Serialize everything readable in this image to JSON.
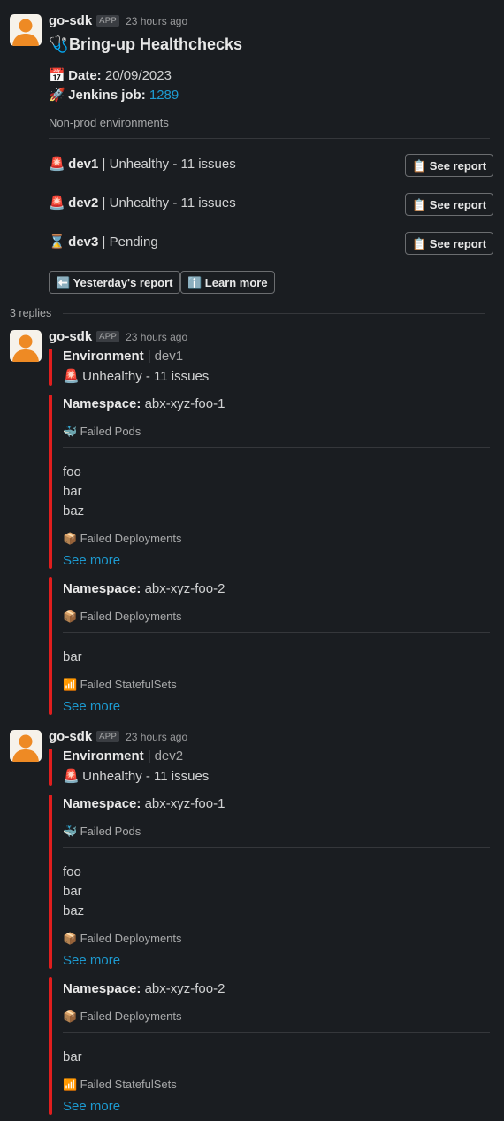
{
  "main": {
    "username": "go-sdk",
    "badge": "APP",
    "timestamp": "23 hours ago",
    "title_icon": "🩺",
    "title": "Bring-up Healthchecks",
    "date_icon": "📅",
    "date_label": "Date:",
    "date_value": "20/09/2023",
    "jenkins_icon": "🚀",
    "jenkins_label": "Jenkins job:",
    "jenkins_value": "1289",
    "section_label": "Non-prod environments",
    "environments": [
      {
        "icon": "🚨",
        "name": "dev1",
        "status": "| Unhealthy - 11 issues",
        "button": "📋 See report"
      },
      {
        "icon": "🚨",
        "name": "dev2",
        "status": "| Unhealthy - 11 issues",
        "button": "📋 See report"
      },
      {
        "icon": "⌛",
        "name": "dev3",
        "status": "| Pending",
        "button": "📋 See report"
      }
    ],
    "actions": {
      "yesterday": "⬅️ Yesterday's report",
      "learn_more": "ℹ️ Learn more"
    }
  },
  "replies_count": "3 replies",
  "replies": [
    {
      "username": "go-sdk",
      "badge": "APP",
      "timestamp": "23 hours ago",
      "env_label": "Environment",
      "env_value": "dev1",
      "status_icon": "🚨",
      "status": "Unhealthy - 11 issues",
      "namespaces": [
        {
          "label": "Namespace:",
          "name": "abx-xyz-foo-1",
          "cat1_icon": "🐳",
          "cat1": "Failed Pods",
          "items": [
            "foo",
            "bar",
            "baz"
          ],
          "cat2_icon": "📦",
          "cat2": "Failed Deployments",
          "see_more": "See more"
        },
        {
          "label": "Namespace:",
          "name": "abx-xyz-foo-2",
          "cat1_icon": "📦",
          "cat1": "Failed Deployments",
          "items": [
            "bar"
          ],
          "cat2_icon": "📶",
          "cat2": "Failed StatefulSets",
          "see_more": "See more"
        }
      ]
    },
    {
      "username": "go-sdk",
      "badge": "APP",
      "timestamp": "23 hours ago",
      "env_label": "Environment",
      "env_value": "dev2",
      "status_icon": "🚨",
      "status": "Unhealthy - 11 issues",
      "namespaces": [
        {
          "label": "Namespace:",
          "name": "abx-xyz-foo-1",
          "cat1_icon": "🐳",
          "cat1": "Failed Pods",
          "items": [
            "foo",
            "bar",
            "baz"
          ],
          "cat2_icon": "📦",
          "cat2": "Failed Deployments",
          "see_more": "See more"
        },
        {
          "label": "Namespace:",
          "name": "abx-xyz-foo-2",
          "cat1_icon": "📦",
          "cat1": "Failed Deployments",
          "items": [
            "bar"
          ],
          "cat2_icon": "📶",
          "cat2": "Failed StatefulSets",
          "see_more": "See more"
        }
      ]
    }
  ]
}
